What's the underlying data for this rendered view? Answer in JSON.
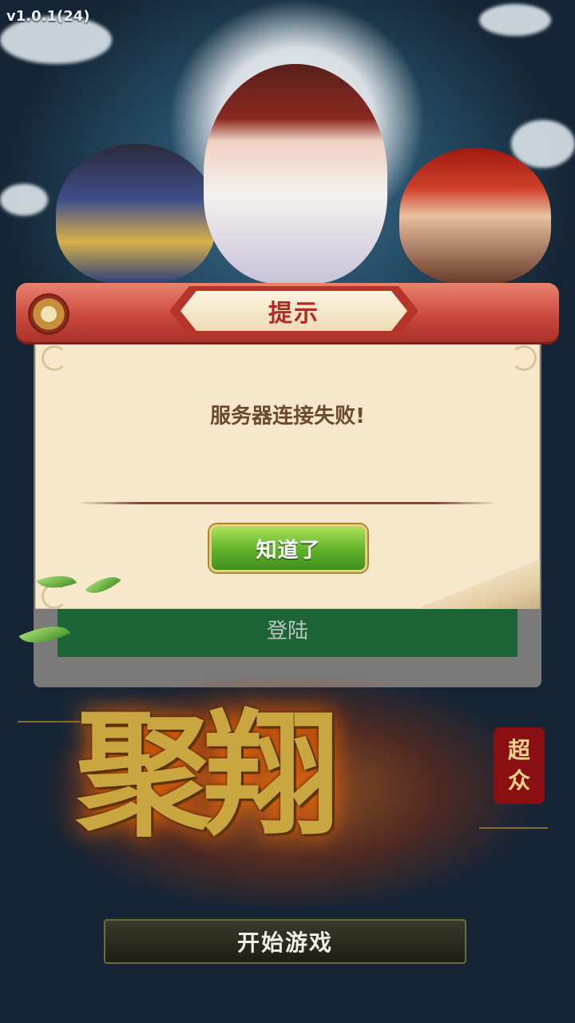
{
  "app": {
    "version": "v1.0.1(24)"
  },
  "login": {
    "login_button_label": "登陆"
  },
  "logo": {
    "title": "聚翔",
    "seal_chars": [
      "超",
      "众"
    ]
  },
  "start": {
    "start_button_label": "开始游戏"
  },
  "dialog": {
    "title": "提示",
    "message": "服务器连接失败!",
    "ok_button_label": "知道了"
  },
  "colors": {
    "dialog_header": "#c9473b",
    "dialog_body": "#f7e8cc",
    "ok_button": "#5fb12a",
    "login_button": "#1c6336"
  }
}
